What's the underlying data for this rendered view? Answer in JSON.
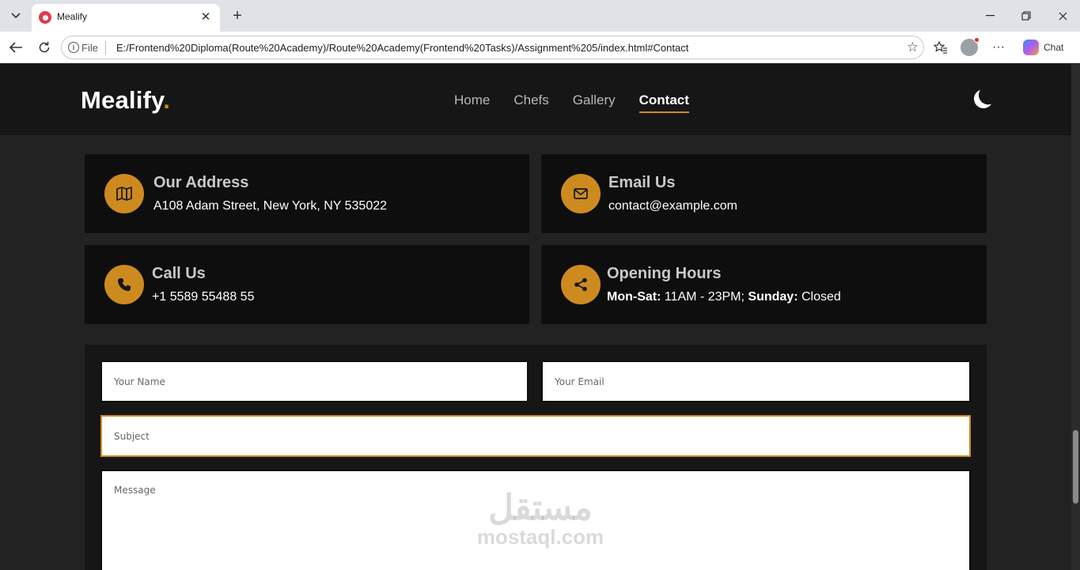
{
  "browser": {
    "tab_title": "Mealify",
    "new_tab_symbol": "+",
    "address_prefix": "File",
    "url": "E:/Frontend%20Diploma(Route%20Academy)/Route%20Academy(Frontend%20Tasks)/Assignment%205/index.html#Contact",
    "chat_label": "Chat"
  },
  "site": {
    "logo_text": "Mealify",
    "logo_dot": ".",
    "accent_color": "#cd8b1f",
    "nav": [
      {
        "label": "Home",
        "active": false
      },
      {
        "label": "Chefs",
        "active": false
      },
      {
        "label": "Gallery",
        "active": false
      },
      {
        "label": "Contact",
        "active": true
      }
    ]
  },
  "contact_cards": {
    "address": {
      "icon": "map-icon",
      "title": "Our Address",
      "text": "A108 Adam Street, New York, NY 535022"
    },
    "email": {
      "icon": "envelope-icon",
      "title": "Email Us",
      "text": "contact@example.com"
    },
    "call": {
      "icon": "phone-icon",
      "title": "Call Us",
      "text": "+1 5589 55488 55"
    },
    "hours": {
      "icon": "share-icon",
      "title": "Opening Hours",
      "weekday_label": "Mon-Sat:",
      "weekday_value": " 11AM - 23PM; ",
      "sunday_label": "Sunday:",
      "sunday_value": " Closed"
    }
  },
  "form": {
    "name_placeholder": "Your Name",
    "email_placeholder": "Your Email",
    "subject_placeholder": "Subject",
    "message_placeholder": "Message"
  },
  "watermark": {
    "arabic": "مستقل",
    "latin": "mostaql.com"
  }
}
